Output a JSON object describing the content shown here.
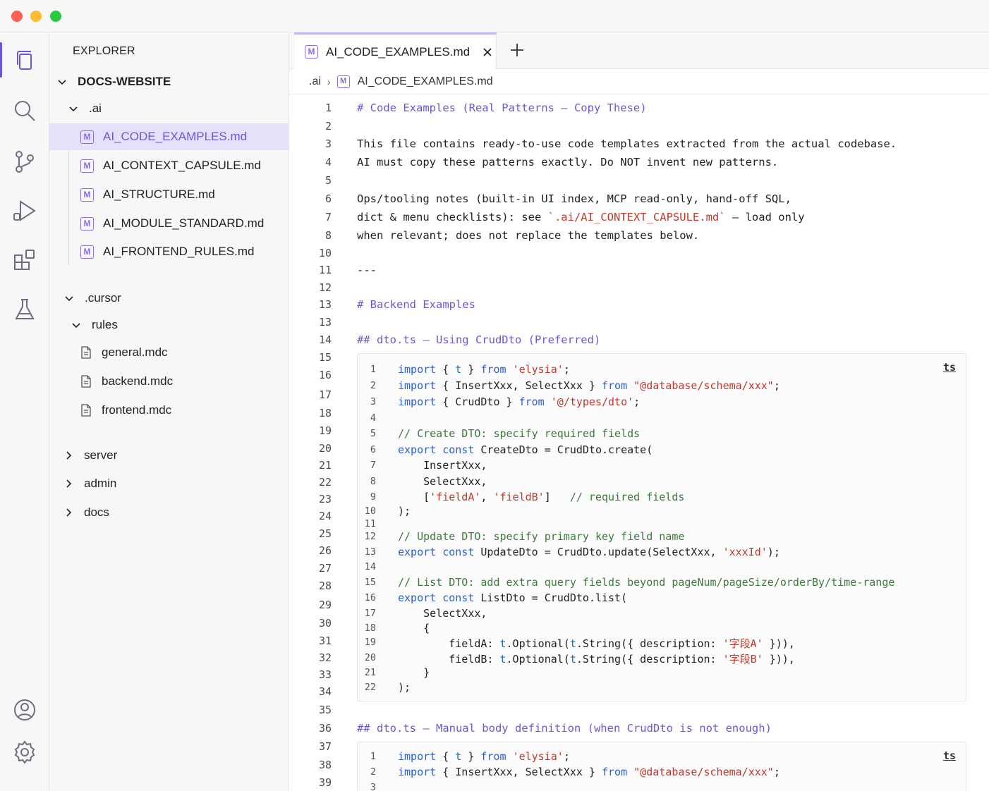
{
  "explorer": {
    "title": "EXPLORER",
    "root": "DOCS-WEBSITE",
    "ai_folder": ".ai",
    "ai_files": [
      "AI_CODE_EXAMPLES.md",
      "AI_CONTEXT_CAPSULE.md",
      "AI_STRUCTURE.md",
      "AI_MODULE_STANDARD.md",
      "AI_FRONTEND_RULES.md"
    ],
    "cursor_folder": ".cursor",
    "rules_folder": "rules",
    "rules_files": [
      "general.mdc",
      "backend.mdc",
      "frontend.mdc"
    ],
    "collapsed_folders": [
      "server",
      "admin",
      "docs"
    ]
  },
  "tab": {
    "label": "AI_CODE_EXAMPLES.md",
    "icon_letter": "M"
  },
  "breadcrumb": {
    "folder": ".ai",
    "file": "AI_CODE_EXAMPLES.md"
  },
  "gutter": [
    "1",
    "2",
    "3",
    "4",
    "5",
    "6",
    "7",
    "8",
    "10",
    "11",
    "12",
    "13",
    "13",
    "14",
    "15",
    "16",
    "17",
    "18",
    "19",
    "20",
    "21",
    "22",
    "23",
    "24",
    "25",
    "26",
    "27",
    "28",
    "29",
    "30",
    "31",
    "32",
    "33",
    "34",
    "35",
    "36",
    "37",
    "38",
    "39"
  ],
  "doc": {
    "l1": "# Code Examples (Real Patterns — Copy These)",
    "l3": "This file contains ready-to-use code templates extracted from the actual codebase.",
    "l4": "AI must copy these patterns exactly. Do NOT invent new patterns.",
    "l6": "Ops/tooling notes (built-in UI index, MCP read-only, hand-off SQL,",
    "l7a": "dict & menu checklists): see ",
    "l7b": "`.ai/AI_CONTEXT_CAPSULE.md`",
    "l7c": " — load only",
    "l8": "when relevant; does not replace the templates below.",
    "l11": "---",
    "l13": "# Backend Examples",
    "l14": "## dto.ts — Using CrudDto (Preferred)",
    "l36": "## dto.ts — Manual body definition (when CrudDto is not enough)"
  },
  "code1": {
    "lang": "ts",
    "nums": [
      "1",
      "2",
      "3",
      "4",
      "5",
      "6",
      "7",
      "8",
      "9",
      "10",
      "11",
      "12",
      "13",
      "14",
      "15",
      "16",
      "17",
      "18",
      "19",
      "20",
      "21",
      "22"
    ]
  },
  "code2": {
    "lang": "ts",
    "nums": [
      "1",
      "2",
      "3"
    ]
  }
}
